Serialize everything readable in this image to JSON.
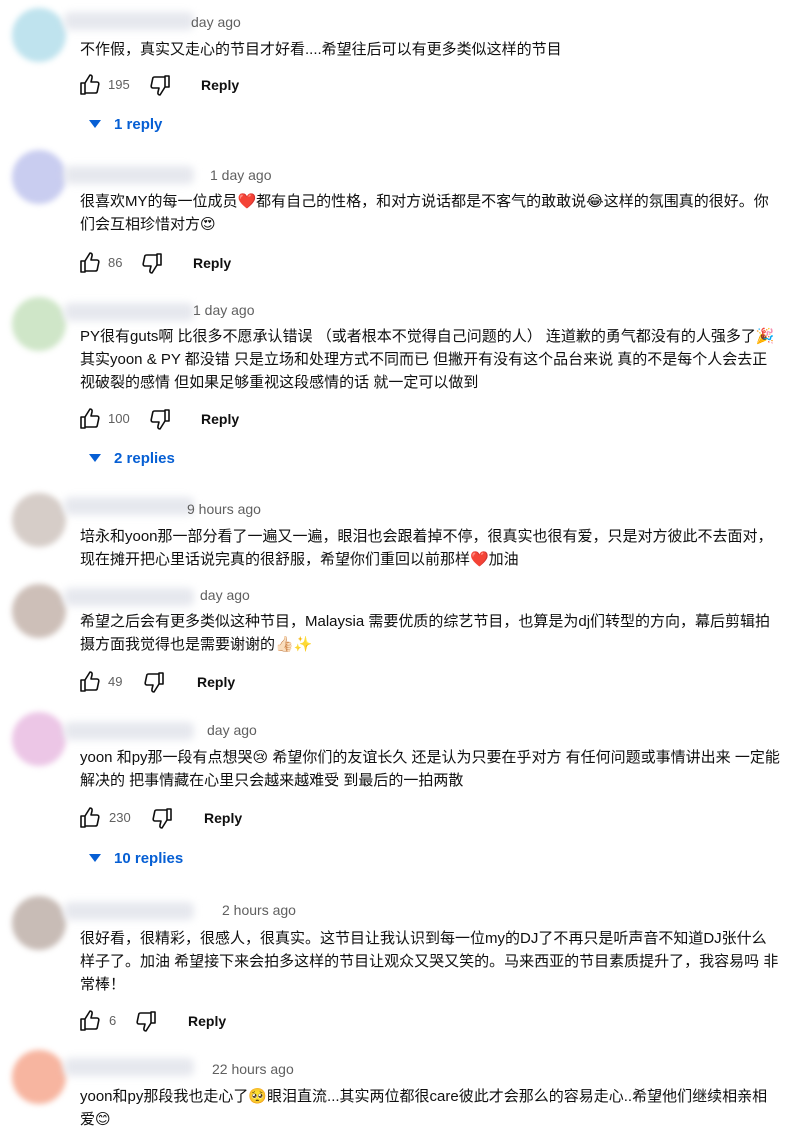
{
  "comments": [
    {
      "time": "day ago",
      "text": "不作假，真实又走心的节目才好看....希望往后可以有更多类似这样的节目",
      "likes": "195",
      "reply": "Reply",
      "replies": "1 reply",
      "avatar_color": "#bfe3ee"
    },
    {
      "time": "1 day ago",
      "text": "很喜欢MY的每一位成员❤️都有自己的性格，和对方说话都是不客气的敢敢说😂这样的氛围真的很好。你们会互相珍惜对方😍",
      "likes": "86",
      "reply": "Reply",
      "replies": "",
      "avatar_color": "#c9cdf0"
    },
    {
      "time": "1 day ago",
      "text": "PY很有guts啊 比很多不愿承认错误 （或者根本不觉得自己问题的人） 连道歉的勇气都没有的人强多了🎉 其实yoon & PY 都没错 只是立场和处理方式不同而已 但撇开有没有这个品台来说 真的不是每个人会去正视破裂的感情 但如果足够重视这段感情的话 就一定可以做到",
      "likes": "100",
      "reply": "Reply",
      "replies": "2 replies",
      "avatar_color": "#cfe6c8"
    },
    {
      "time": "9 hours ago",
      "text": "培永和yoon那一部分看了一遍又一遍，眼泪也会跟着掉不停，很真实也很有爱，只是对方彼此不去面对，现在摊开把心里话说完真的很舒服，希望你们重回以前那样❤️加油",
      "likes": "",
      "reply": "",
      "replies": "",
      "avatar_color": "#d6cdc8"
    },
    {
      "time": "day ago",
      "text": "希望之后会有更多类似这种节目，Malaysia 需要优质的综艺节目，也算是为dj们转型的方向，幕后剪辑拍摄方面我觉得也是需要谢谢的👍🏻✨",
      "likes": "49",
      "reply": "Reply",
      "replies": "",
      "avatar_color": "#cdbfb8"
    },
    {
      "time": "day ago",
      "text": "yoon 和py那一段有点想哭😢 希望你们的友谊长久 还是认为只要在乎对方 有任何问题或事情讲出来 一定能解决的 把事情藏在心里只会越来越难受 到最后的一拍两散",
      "likes": "230",
      "reply": "Reply",
      "replies": "10 replies",
      "avatar_color": "#ecc6e6"
    },
    {
      "time": "2 hours ago",
      "text": "很好看，很精彩，很感人，很真实。这节目让我认识到每一位my的DJ了不再只是听声音不知道DJ张什么样子了。加油 希望接下来会拍多这样的节目让观众又哭又笑的。马来西亚的节目素质提升了，我容易吗 非常棒！",
      "likes": "6",
      "reply": "Reply",
      "replies": "",
      "avatar_color": "#c8bcb6"
    },
    {
      "time": "22 hours ago",
      "text": "yoon和py那段我也走心了🥺眼泪直流...其实两位都很care彼此才会那么的容易走心..希望他们继续相亲相爱😊",
      "likes": "",
      "reply": "",
      "replies": "",
      "avatar_color": "#f7b5a0"
    }
  ],
  "colors": {
    "link": "#065fd4",
    "meta": "#606060",
    "text": "#0f0f0f"
  }
}
